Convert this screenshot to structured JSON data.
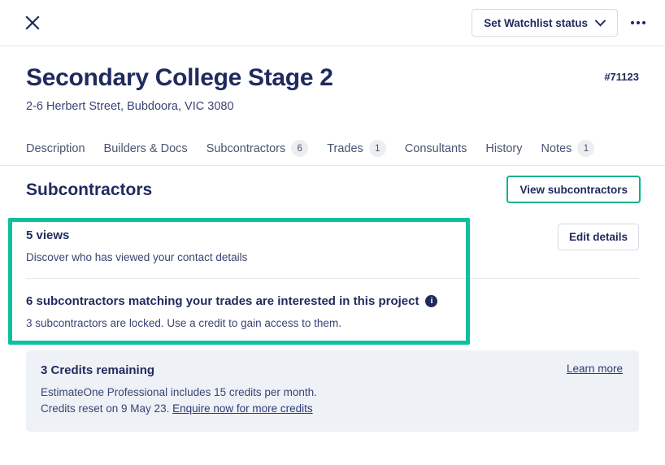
{
  "topbar": {
    "close_label": "close",
    "watchlist_button": "Set Watchlist status",
    "more_label": "more options"
  },
  "project": {
    "title": "Secondary College Stage 2",
    "address": "2-6 Herbert Street, Bubdoora, VIC 3080",
    "reference": "#71123"
  },
  "tabs": [
    {
      "label": "Description",
      "badge": ""
    },
    {
      "label": "Builders & Docs",
      "badge": ""
    },
    {
      "label": "Subcontractors",
      "badge": "6"
    },
    {
      "label": "Trades",
      "badge": "1"
    },
    {
      "label": "Consultants",
      "badge": ""
    },
    {
      "label": "History",
      "badge": ""
    },
    {
      "label": "Notes",
      "badge": "1"
    }
  ],
  "section": {
    "title": "Subcontractors",
    "view_button": "View subcontractors"
  },
  "insights": [
    {
      "title": "5 views",
      "subtitle": "Discover who has viewed your contact details",
      "action": "Edit details"
    },
    {
      "title": "6 subcontractors matching your trades are interested in this project",
      "info_glyph": "i",
      "subtitle": "3 subcontractors are locked. Use a credit to gain access to them."
    }
  ],
  "credits": {
    "title": "3 Credits remaining",
    "line1": "EstimateOne Professional includes 15 credits per month.",
    "line2_prefix": "Credits reset on 9 May 23. ",
    "line2_link": "Enquire now for more credits",
    "learn_more": "Learn more"
  },
  "colors": {
    "brand_navy": "#1f2a5e",
    "accent_green": "#0ab18c",
    "highlight_green": "#0ec0a0",
    "panel_bg": "#eef1f6"
  }
}
